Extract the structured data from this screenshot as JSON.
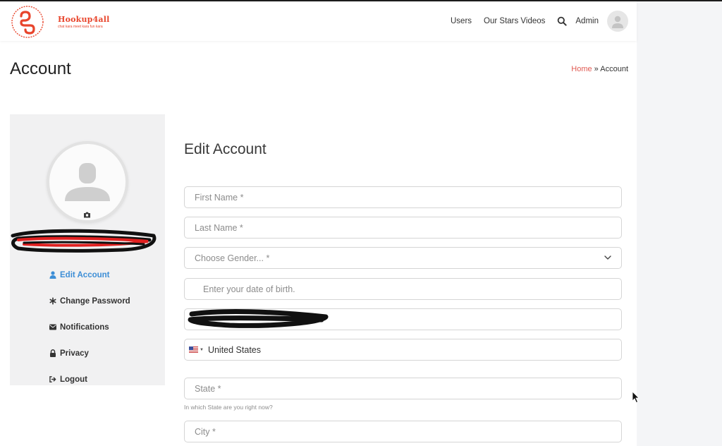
{
  "header": {
    "logo_text": "Hookup4all",
    "logo_tagline": "chat kara meet kara fun kara",
    "nav": [
      {
        "label": "Users"
      },
      {
        "label": "Our Stars Videos"
      }
    ],
    "admin_label": "Admin"
  },
  "page": {
    "title": "Account",
    "breadcrumb": {
      "home": "Home",
      "separator": " » ",
      "current": "Account"
    }
  },
  "sidebar": {
    "menu": [
      {
        "label": "Edit Account",
        "icon": "user-icon",
        "active": true
      },
      {
        "label": "Change Password",
        "icon": "asterisk-icon",
        "active": false
      },
      {
        "label": "Notifications",
        "icon": "envelope-icon",
        "active": false
      },
      {
        "label": "Privacy",
        "icon": "lock-icon",
        "active": false
      },
      {
        "label": "Logout",
        "icon": "sign-out-icon",
        "active": false
      }
    ]
  },
  "form": {
    "title": "Edit Account",
    "first_name_placeholder": "First Name *",
    "last_name_placeholder": "Last Name *",
    "gender_placeholder": "Choose Gender... *",
    "dob_placeholder": "Enter your date of birth.",
    "country_value": "United States",
    "state_placeholder": "State *",
    "state_help": "In which State are you right now?",
    "city_placeholder": "City *"
  },
  "colors": {
    "accent_blue": "#3d8ed6",
    "brand_red": "#e8452c",
    "breadcrumb_home": "#e05a52"
  }
}
